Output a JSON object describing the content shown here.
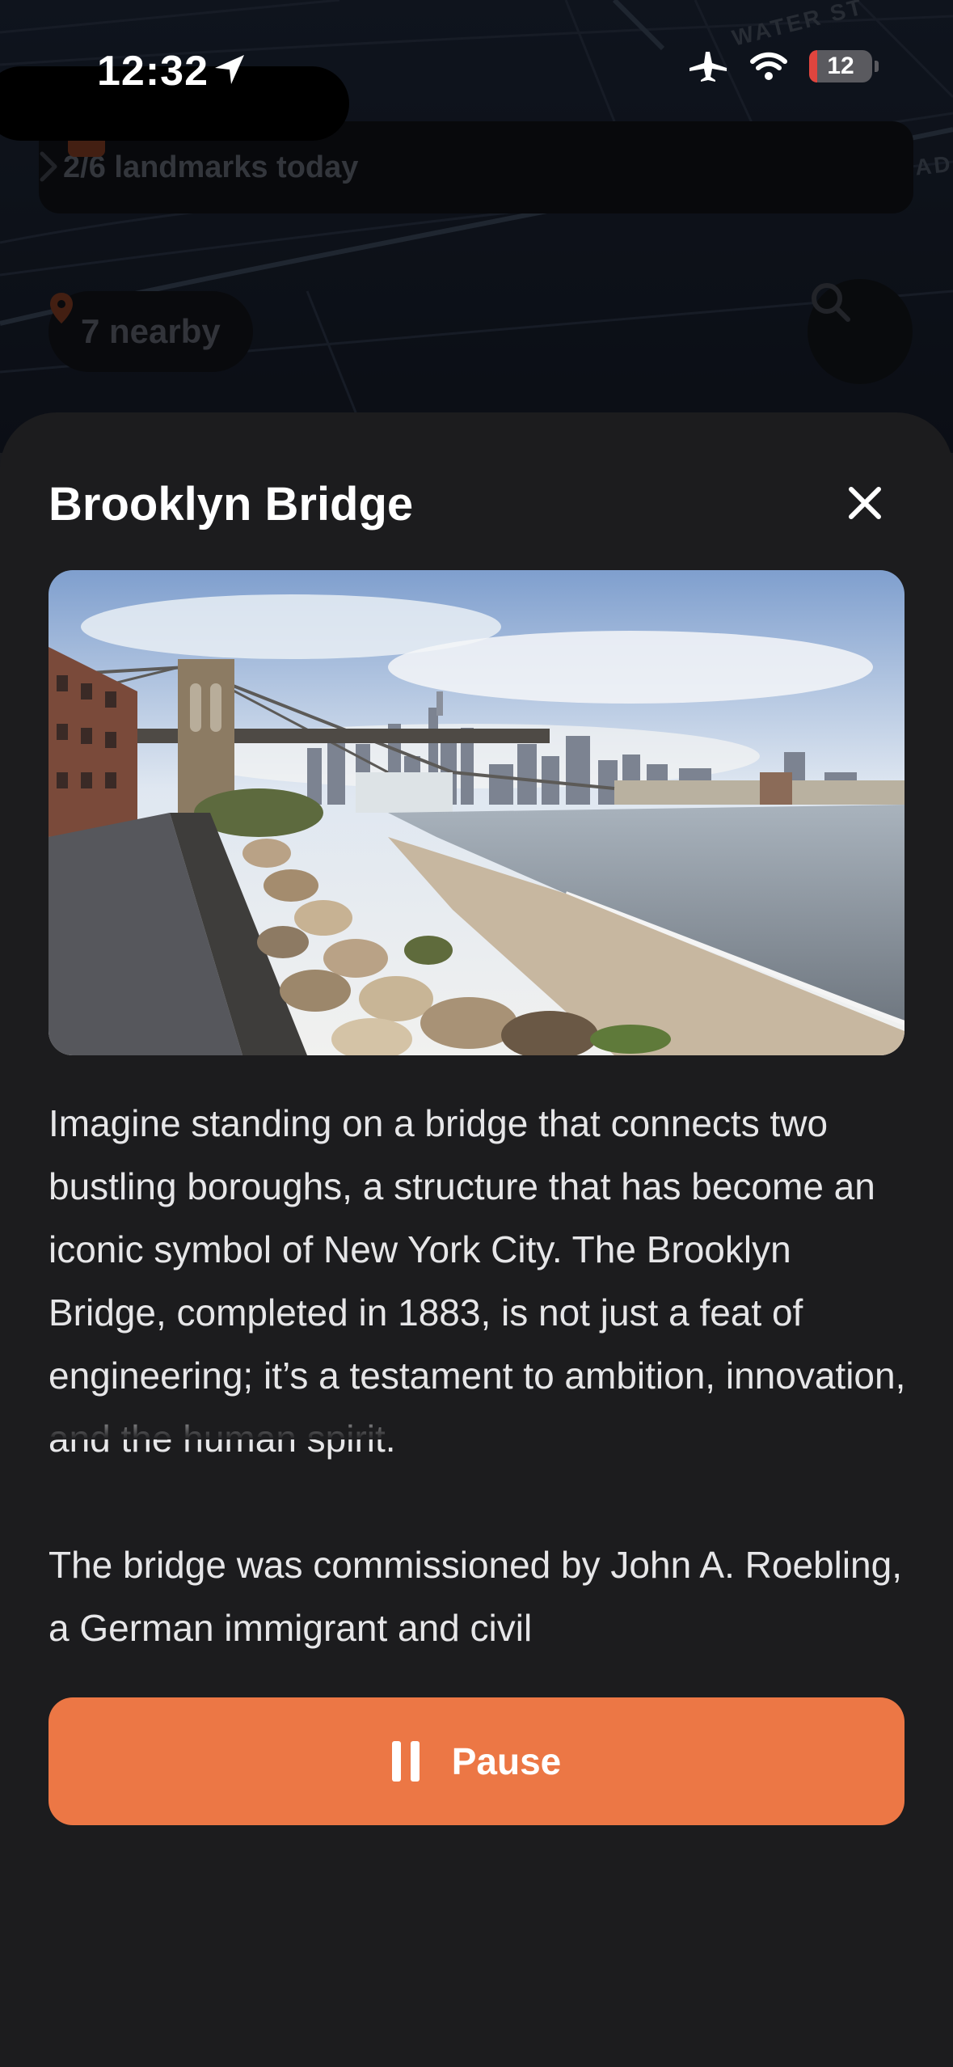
{
  "status_bar": {
    "time": "12:32",
    "battery": "12"
  },
  "map": {
    "street_label": "WATER ST",
    "street_label_2": "ADU",
    "banner_text": "2/6 landmarks today",
    "nearby_text": "7 nearby"
  },
  "sheet": {
    "title": "Brooklyn Bridge",
    "paragraphs": [
      "Imagine standing on a bridge that connects two bustling boroughs, a structure that has become an iconic symbol of New York City. The Brooklyn Bridge, completed in 1883, is not just a feat of engineering; it’s a testament to ambition, innovation, and the human spirit.",
      "The bridge was commissioned by John A. Roebling, a German immigrant and civil"
    ],
    "pause_label": "Pause"
  },
  "colors": {
    "accent": "#ec7745",
    "sheet_bg": "#1c1c1e",
    "text_primary": "#ffffff",
    "text_secondary": "#e6e6e8"
  },
  "icons": {
    "location": "location-arrow-icon",
    "airplane": "airplane-icon",
    "wifi": "wifi-icon",
    "calendar": "calendar-icon",
    "pin": "map-pin-icon",
    "search": "search-icon",
    "close": "close-icon",
    "pause": "pause-icon"
  }
}
